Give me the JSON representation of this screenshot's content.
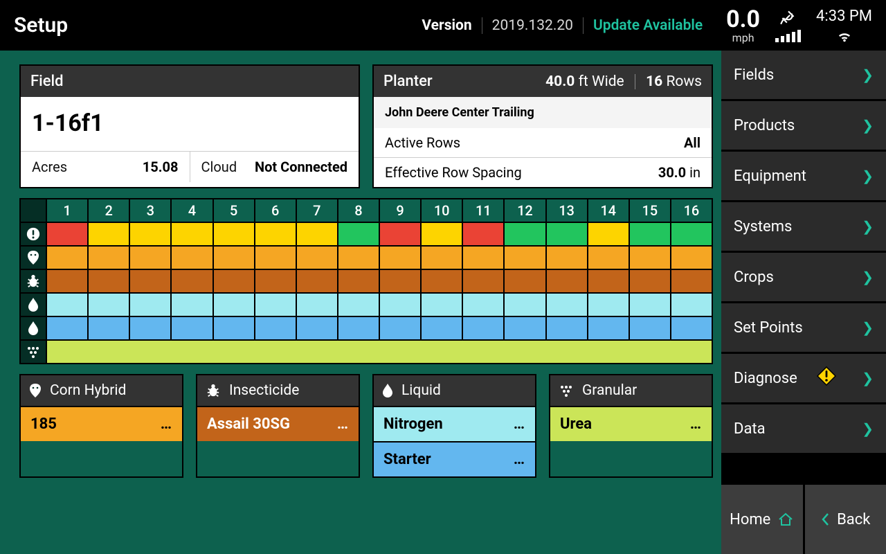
{
  "header": {
    "title": "Setup",
    "version_label": "Version",
    "version_number": "2019.132.20",
    "update_text": "Update Available",
    "speed_value": "0.0",
    "speed_unit": "mph",
    "time": "4:33 PM"
  },
  "field_card": {
    "title": "Field",
    "name": "1-16f1",
    "acres_label": "Acres",
    "acres_value": "15.08",
    "cloud_label": "Cloud",
    "cloud_value": "Not Connected"
  },
  "planter_card": {
    "title": "Planter",
    "width_value": "40.0",
    "width_unit": "ft Wide",
    "rows_value": "16",
    "rows_unit": "Rows",
    "model": "John Deere Center Trailing",
    "active_rows_label": "Active Rows",
    "active_rows_value": "All",
    "spacing_label": "Effective Row Spacing",
    "spacing_value": "30.0",
    "spacing_unit": "in"
  },
  "row_grid": {
    "columns": [
      "1",
      "2",
      "3",
      "4",
      "5",
      "6",
      "7",
      "8",
      "9",
      "10",
      "11",
      "12",
      "13",
      "14",
      "15",
      "16"
    ],
    "rows": [
      {
        "icon": "alert",
        "joined": false,
        "cells": [
          "red",
          "yel",
          "yel",
          "yel",
          "yel",
          "yel",
          "yel",
          "grn",
          "red",
          "yel",
          "red",
          "grn",
          "grn",
          "yel",
          "grn",
          "grn"
        ]
      },
      {
        "icon": "seed",
        "joined": false,
        "cells": [
          "orange",
          "orange",
          "orange",
          "orange",
          "orange",
          "orange",
          "orange",
          "orange",
          "orange",
          "orange",
          "orange",
          "orange",
          "orange",
          "orange",
          "orange",
          "orange"
        ]
      },
      {
        "icon": "bug",
        "joined": false,
        "cells": [
          "brown",
          "brown",
          "brown",
          "brown",
          "brown",
          "brown",
          "brown",
          "brown",
          "brown",
          "brown",
          "brown",
          "brown",
          "brown",
          "brown",
          "brown",
          "brown"
        ]
      },
      {
        "icon": "drop",
        "joined": false,
        "cells": [
          "cyan",
          "cyan",
          "cyan",
          "cyan",
          "cyan",
          "cyan",
          "cyan",
          "cyan",
          "cyan",
          "cyan",
          "cyan",
          "cyan",
          "cyan",
          "cyan",
          "cyan",
          "cyan"
        ]
      },
      {
        "icon": "drop",
        "joined": false,
        "cells": [
          "blue",
          "blue",
          "blue",
          "blue",
          "blue",
          "blue",
          "blue",
          "blue",
          "blue",
          "blue",
          "blue",
          "blue",
          "blue",
          "blue",
          "blue",
          "blue"
        ]
      },
      {
        "icon": "granular",
        "joined": true,
        "color": "lime"
      }
    ]
  },
  "products": {
    "hybrid": {
      "title": "Corn Hybrid",
      "items": [
        {
          "name": "185",
          "color": "orange"
        }
      ]
    },
    "insecticide": {
      "title": "Insecticide",
      "items": [
        {
          "name": "Assail 30SG",
          "color": "brown"
        }
      ]
    },
    "liquid": {
      "title": "Liquid",
      "items": [
        {
          "name": "Nitrogen",
          "color": "cyan"
        },
        {
          "name": "Starter",
          "color": "blue"
        }
      ]
    },
    "granular": {
      "title": "Granular",
      "items": [
        {
          "name": "Urea",
          "color": "lime"
        }
      ]
    }
  },
  "sidebar": {
    "items": [
      {
        "label": "Fields"
      },
      {
        "label": "Products"
      },
      {
        "label": "Equipment"
      },
      {
        "label": "Systems"
      },
      {
        "label": "Crops"
      },
      {
        "label": "Set Points"
      },
      {
        "label": "Diagnose",
        "warn": true
      },
      {
        "label": "Data"
      }
    ],
    "home": "Home",
    "back": "Back"
  }
}
